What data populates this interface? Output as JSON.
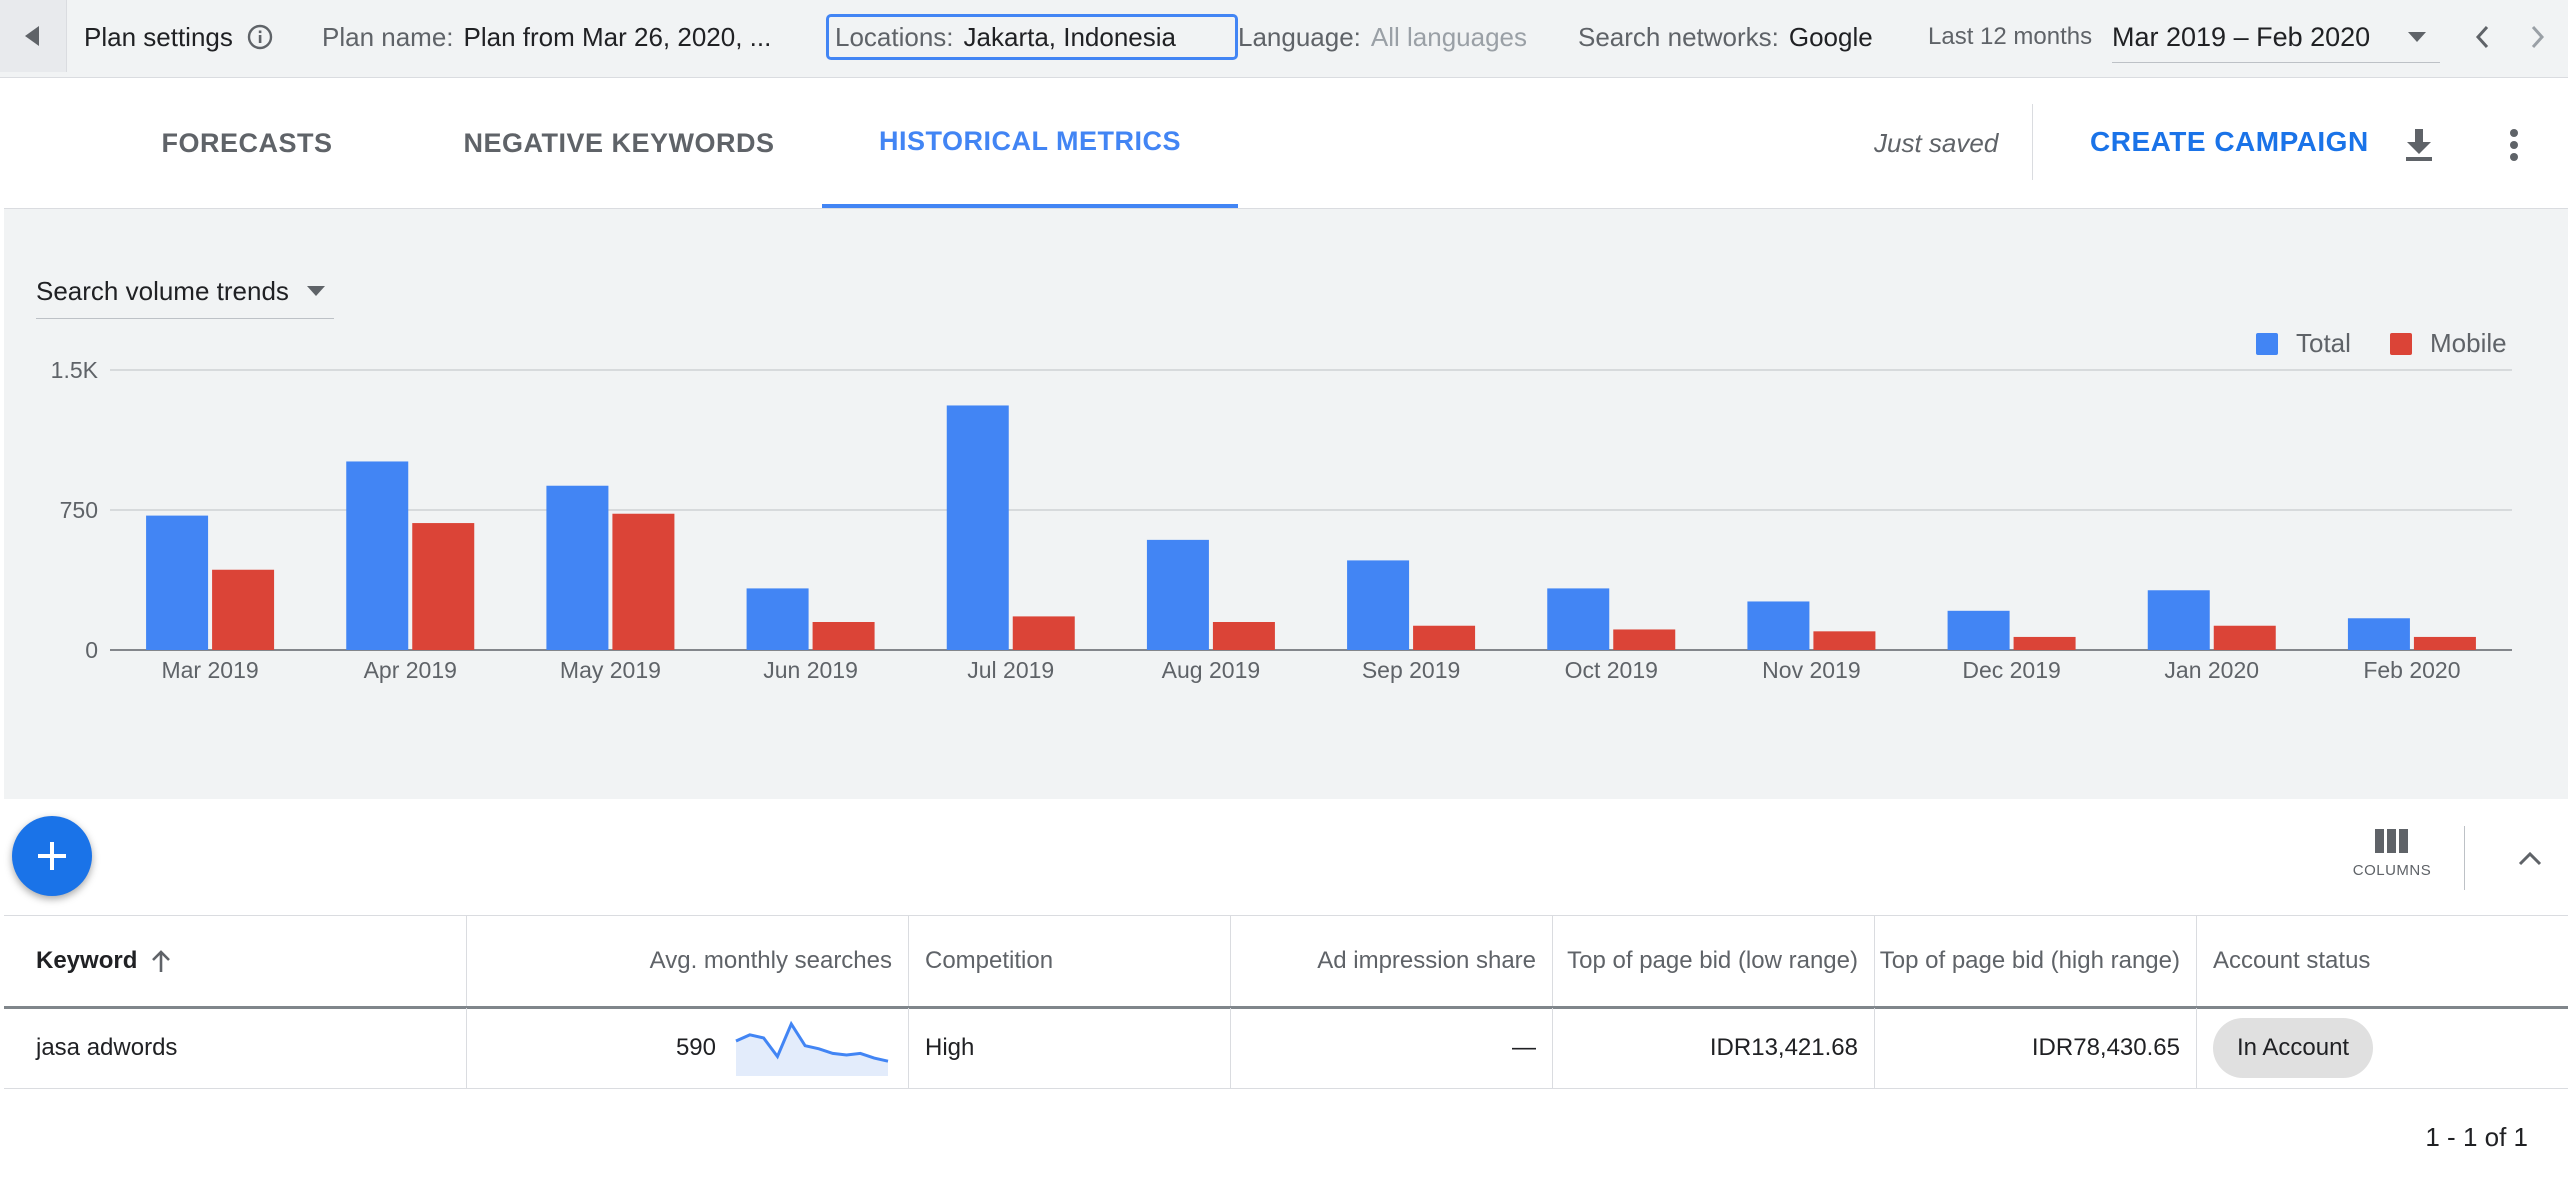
{
  "settings_bar": {
    "title": "Plan settings",
    "plan_name_label": "Plan name:",
    "plan_name_value": "Plan from Mar 26, 2020, ...",
    "locations_label": "Locations:",
    "locations_value": "Jakarta, Indonesia",
    "language_label": "Language:",
    "language_value": "All languages",
    "networks_label": "Search networks:",
    "networks_value": "Google",
    "range_label": "Last 12 months",
    "range_value": "Mar 2019 – Feb 2020"
  },
  "header": {
    "tabs": [
      {
        "label": "FORECASTS",
        "active": false
      },
      {
        "label": "NEGATIVE KEYWORDS",
        "active": false
      },
      {
        "label": "HISTORICAL METRICS",
        "active": true
      }
    ],
    "status": "Just saved",
    "create_campaign": "CREATE CAMPAIGN"
  },
  "chart_selector": "Search volume trends",
  "chart_data": {
    "type": "bar",
    "categories": [
      "Mar 2019",
      "Apr 2019",
      "May 2019",
      "Jun 2019",
      "Jul 2019",
      "Aug 2019",
      "Sep 2019",
      "Oct 2019",
      "Nov 2019",
      "Dec 2019",
      "Jan 2020",
      "Feb 2020"
    ],
    "series": [
      {
        "name": "Total",
        "color": "#4285f4",
        "values": [
          720,
          1010,
          880,
          330,
          1310,
          590,
          480,
          330,
          260,
          210,
          320,
          170
        ]
      },
      {
        "name": "Mobile",
        "color": "#db4437",
        "values": [
          430,
          680,
          730,
          150,
          180,
          150,
          130,
          110,
          100,
          70,
          130,
          70
        ]
      }
    ],
    "yticks": [
      "0",
      "750",
      "1.5K"
    ],
    "ytick_values": [
      0,
      750,
      1500
    ],
    "ylim": [
      0,
      1500
    ],
    "grid": true,
    "legend_position": "top-right"
  },
  "table": {
    "columns_label": "COLUMNS",
    "headers": {
      "keyword": "Keyword",
      "avg_searches": "Avg. monthly searches",
      "competition": "Competition",
      "impression_share": "Ad impression share",
      "bid_low": "Top of page bid (low range)",
      "bid_high": "Top of page bid (high range)",
      "account_status": "Account status"
    },
    "rows": [
      {
        "keyword": "jasa adwords",
        "avg_searches": "590",
        "trend": [
          40,
          48,
          44,
          20,
          62,
          34,
          30,
          24,
          22,
          24,
          18,
          14
        ],
        "competition": "High",
        "impression_share": "—",
        "bid_low": "IDR13,421.68",
        "bid_high": "IDR78,430.65",
        "account_status": "In Account"
      }
    ],
    "pagination": "1 - 1 of 1"
  }
}
